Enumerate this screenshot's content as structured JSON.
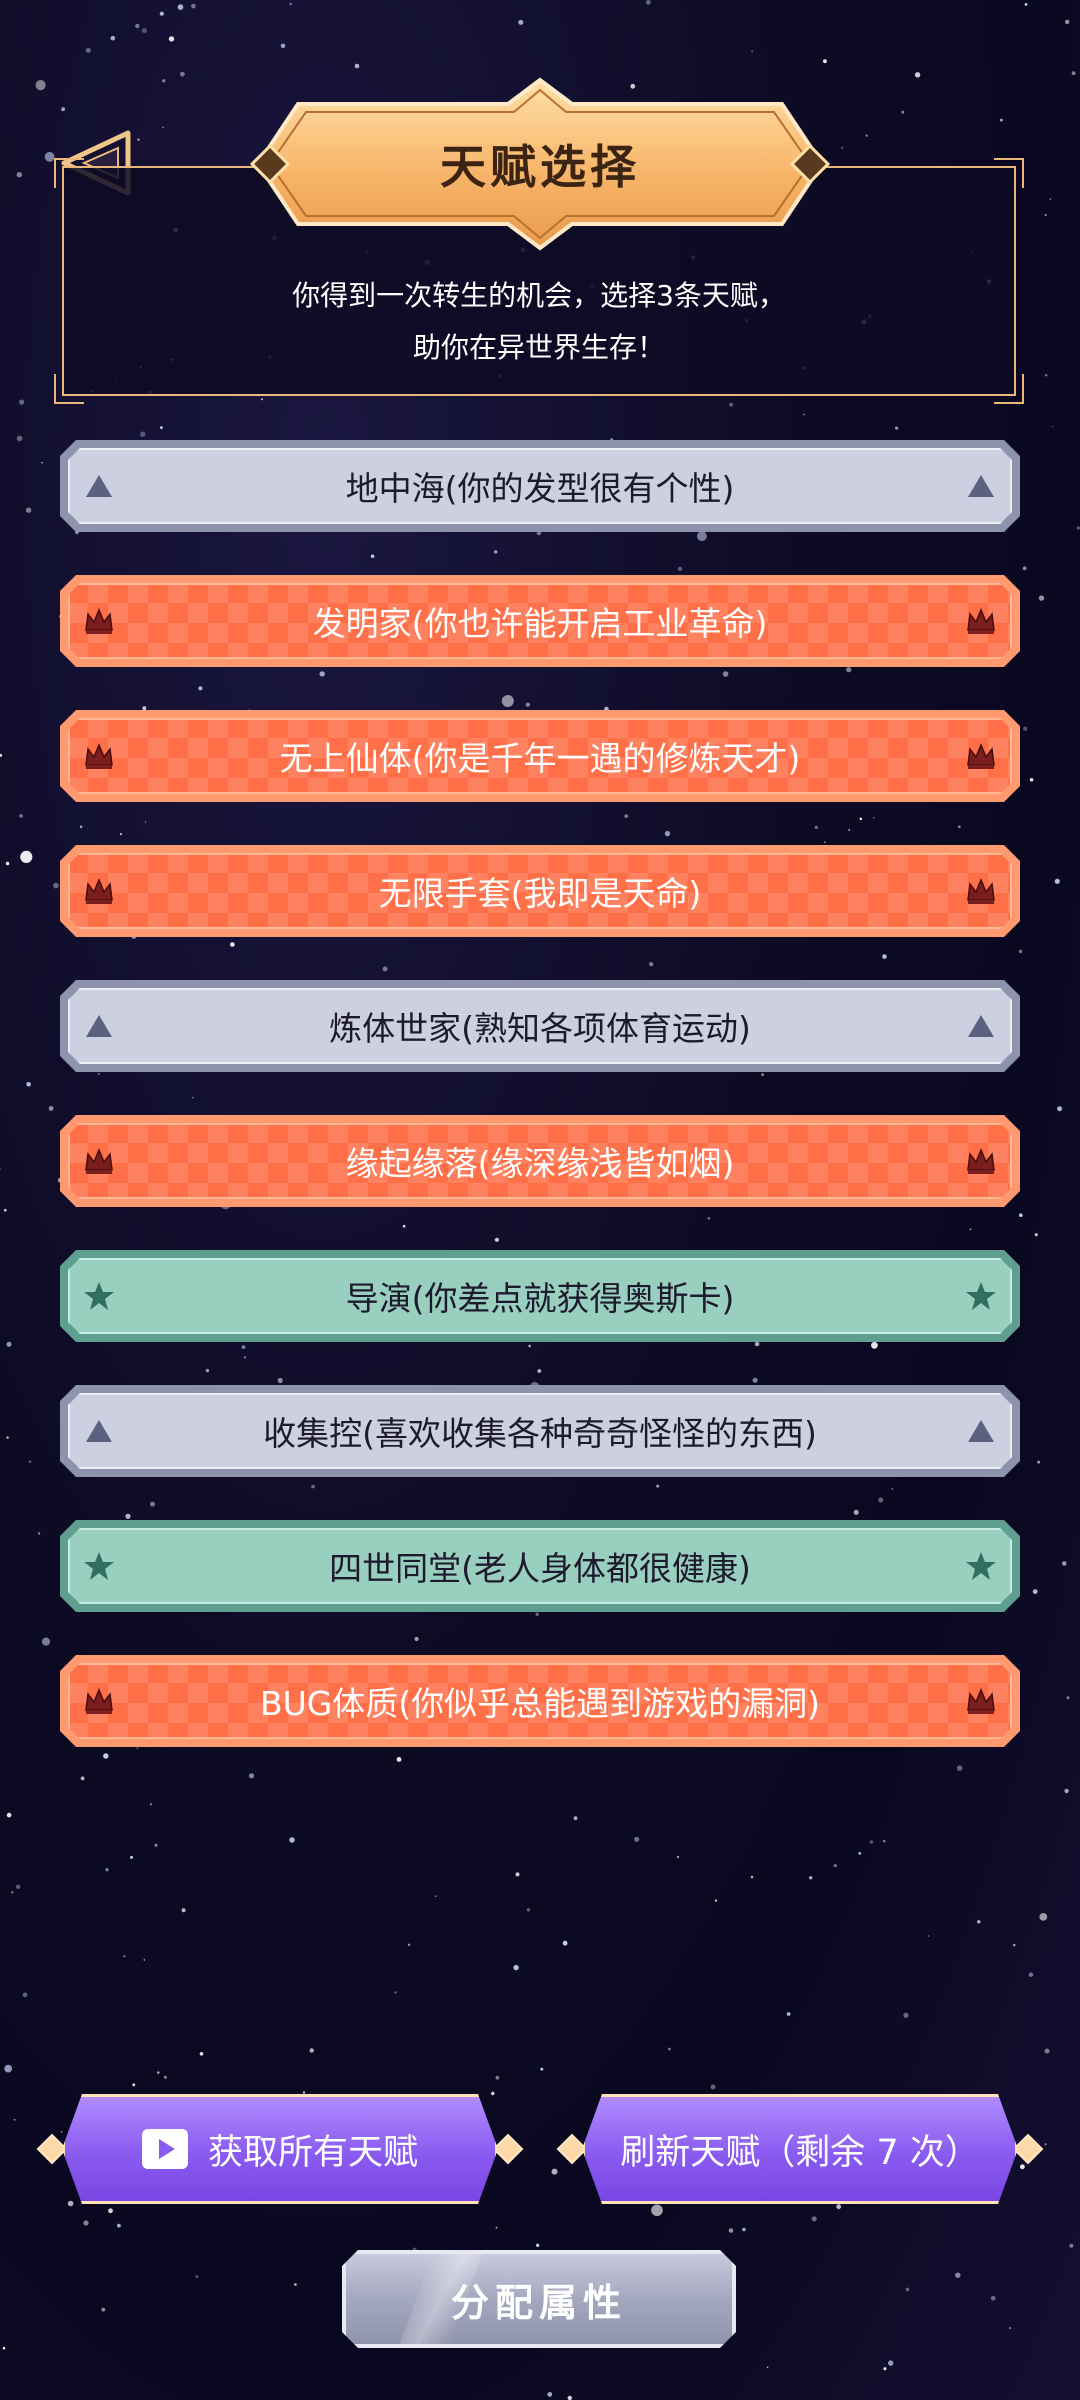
{
  "header": {
    "title": "天赋选择",
    "description_line1": "你得到一次转生的机会，选择3条天赋，",
    "description_line2": "助你在异世界生存！",
    "back_icon": "triangle-back-icon"
  },
  "talents": [
    {
      "label": "地中海(你的发型很有个性)",
      "rarity": "gray",
      "icon": "triangle-icon"
    },
    {
      "label": "发明家(你也许能开启工业革命)",
      "rarity": "orange",
      "icon": "crown-icon"
    },
    {
      "label": "无上仙体(你是千年一遇的修炼天才)",
      "rarity": "orange",
      "icon": "crown-icon"
    },
    {
      "label": "无限手套(我即是天命)",
      "rarity": "orange",
      "icon": "crown-icon"
    },
    {
      "label": "炼体世家(熟知各项体育运动)",
      "rarity": "gray",
      "icon": "triangle-icon"
    },
    {
      "label": "缘起缘落(缘深缘浅皆如烟)",
      "rarity": "orange",
      "icon": "crown-icon"
    },
    {
      "label": "导演(你差点就获得奥斯卡)",
      "rarity": "green",
      "icon": "star-icon"
    },
    {
      "label": "收集控(喜欢收集各种奇奇怪怪的东西)",
      "rarity": "gray",
      "icon": "triangle-icon"
    },
    {
      "label": "四世同堂(老人身体都很健康)",
      "rarity": "green",
      "icon": "star-icon"
    },
    {
      "label": "BUG体质(你似乎总能遇到游戏的漏洞)",
      "rarity": "orange",
      "icon": "crown-icon"
    }
  ],
  "buttons": {
    "get_all": "获取所有天赋",
    "get_all_icon": "play-video-icon",
    "refresh": "刷新天赋（剩余 7 次）",
    "assign": "分配属性"
  },
  "colors": {
    "gray": "#ccd0e0",
    "orange": "#ff6f48",
    "green": "#99cfbe",
    "gold": "#e9b77c",
    "purple": "#8a5bf0"
  }
}
